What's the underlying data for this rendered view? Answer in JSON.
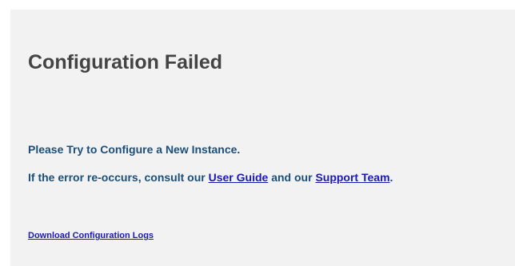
{
  "error": {
    "title": "Configuration Failed",
    "message_line1": "Please Try to Configure a New Instance.",
    "message_line2": {
      "prefix": "If the error re-occurs, consult our ",
      "user_guide_link": "User Guide",
      "middle": " and our ",
      "support_link": "Support Team",
      "suffix": "."
    },
    "download_link": "Download Configuration Logs"
  },
  "colors": {
    "background": "#f2f2f2",
    "title": "#444444",
    "message_text": "#1b4f7a",
    "link": "#1a1ab3"
  }
}
